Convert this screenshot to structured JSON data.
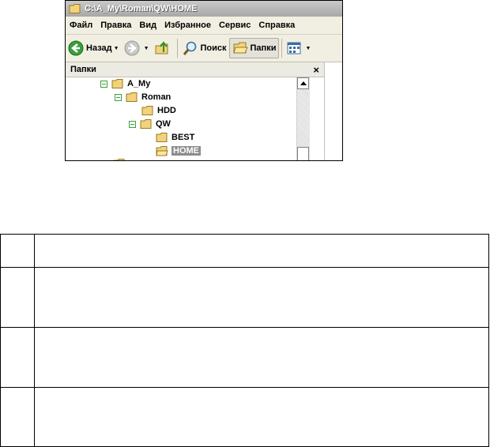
{
  "window": {
    "title": "C:\\A_My\\Roman\\QW\\HOME",
    "menu": [
      "Файл",
      "Правка",
      "Вид",
      "Избранное",
      "Сервис",
      "Справка"
    ],
    "toolbar": {
      "back_label": "Назад",
      "search_label": "Поиск",
      "folders_label": "Папки"
    },
    "panel": {
      "title": "Папки",
      "close_glyph": "×"
    },
    "tree": [
      {
        "label": "A_My",
        "expanded": true,
        "selected": false
      },
      {
        "label": "Roman",
        "expanded": true,
        "selected": false
      },
      {
        "label": "HDD",
        "expanded": false,
        "selected": false
      },
      {
        "label": "QW",
        "expanded": true,
        "selected": false
      },
      {
        "label": "BEST",
        "expanded": false,
        "selected": false
      },
      {
        "label": "HOME",
        "expanded": false,
        "selected": true
      }
    ]
  },
  "table": {
    "rows": 4,
    "columns": 2,
    "cells": [
      [
        "",
        ""
      ],
      [
        "",
        ""
      ],
      [
        "",
        ""
      ],
      [
        "",
        ""
      ]
    ]
  },
  "colors": {
    "selection": "#8c8c8c",
    "expander": "#3aa03a",
    "folder": "#f2d27a"
  }
}
